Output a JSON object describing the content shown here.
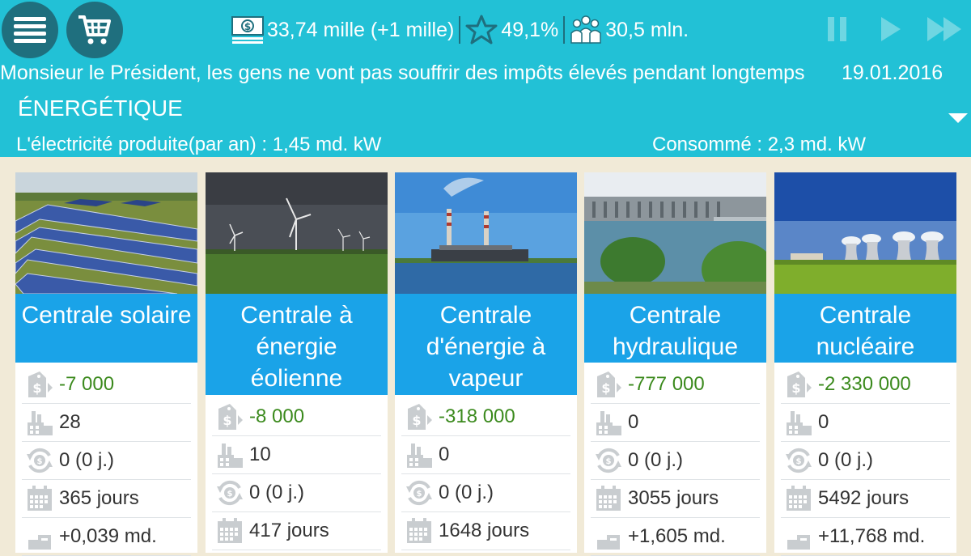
{
  "header": {
    "money": "33,74 mille (+1 mille)",
    "rating": "49,1%",
    "population": "30,5 mln.",
    "ticker": "Monsieur le Président, les gens ne vont pas souffrir des impôts élevés pendant longtemps",
    "date": "19.01.2016",
    "section_title": "ÉNERGÉTIQUE",
    "produced": "L'électricité produite(par an) : 1,45 md. kW",
    "consumed": "Consommé : 2,3 md. kW"
  },
  "icons": {
    "menu": "menu-icon",
    "cart": "cart-icon",
    "money": "money-icon",
    "rating": "star-icon",
    "population": "people-icon",
    "pause": "pause-icon",
    "play": "play-icon",
    "fast_forward": "fast-forward-icon",
    "expand": "triangle-down-icon",
    "row_icons": [
      "price-tag-icon",
      "factory-icon",
      "cycle-coin-icon",
      "calendar-icon",
      "income-icon"
    ]
  },
  "colors": {
    "header_bg": "#22c1d6",
    "dark_button": "#1f6f7e",
    "card_title_bg": "#1aa3e8",
    "page_bg": "#f1ead7",
    "cost_text": "#3b8a1d"
  },
  "plants": [
    {
      "name": "Centrale solaire",
      "photo": "solar-panels",
      "cost": "-7 000",
      "count": "28",
      "income_time": "0 (0 j.)",
      "duration": "365 jours",
      "profit": "+0,039 md."
    },
    {
      "name": "Centrale à énergie éolienne",
      "photo": "wind-turbines",
      "cost": "-8 000",
      "count": "10",
      "income_time": "0 (0 j.)",
      "duration": "417 jours",
      "profit": ""
    },
    {
      "name": "Centrale d'énergie à vapeur",
      "photo": "thermal-plant",
      "cost": "-318 000",
      "count": "0",
      "income_time": "0 (0 j.)",
      "duration": "1648 jours",
      "profit": ""
    },
    {
      "name": "Centrale hydraulique",
      "photo": "hydro-dam",
      "cost": "-777 000",
      "count": "0",
      "income_time": "0 (0 j.)",
      "duration": "3055 jours",
      "profit": "+1,605 md."
    },
    {
      "name": "Centrale nucléaire",
      "photo": "nuclear-towers",
      "cost": "-2 330 000",
      "count": "0",
      "income_time": "0 (0 j.)",
      "duration": "5492 jours",
      "profit": "+11,768 md."
    }
  ]
}
